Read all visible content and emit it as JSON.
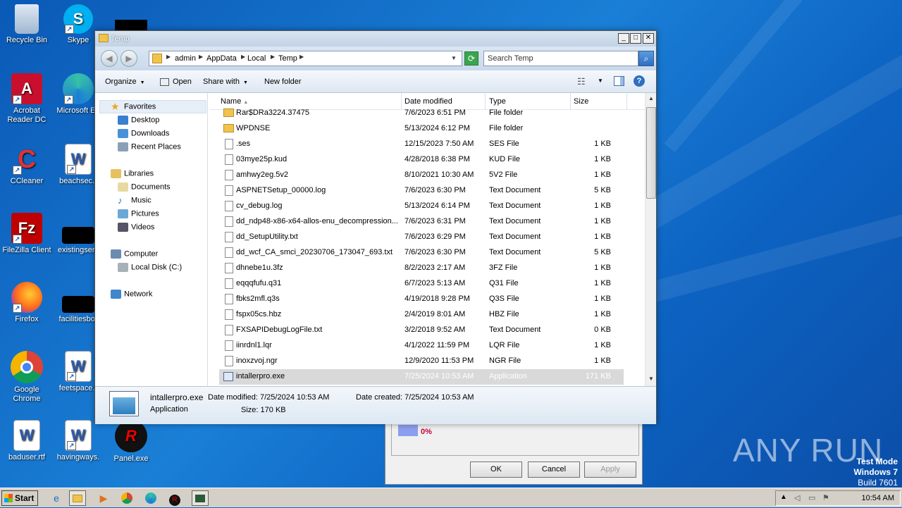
{
  "desktop": {
    "icons": [
      {
        "label": "Recycle Bin",
        "name": "recycle-bin-icon"
      },
      {
        "label": "Skype",
        "name": "skype-icon"
      },
      {
        "label": "Acrobat Reader DC",
        "name": "acrobat-icon"
      },
      {
        "label": "Microsoft Ed",
        "name": "edge-icon"
      },
      {
        "label": "CCleaner",
        "name": "ccleaner-icon"
      },
      {
        "label": "beachsec.r",
        "name": "word-doc-icon"
      },
      {
        "label": "FileZilla Client",
        "name": "filezilla-icon"
      },
      {
        "label": "existingserv",
        "name": "file-icon"
      },
      {
        "label": "Firefox",
        "name": "firefox-icon"
      },
      {
        "label": "facilitiesbor",
        "name": "file-icon"
      },
      {
        "label": "Google Chrome",
        "name": "chrome-icon"
      },
      {
        "label": "feetspace.r",
        "name": "word-doc-icon"
      },
      {
        "label": "baduser.rtf",
        "name": "word-doc-icon"
      },
      {
        "label": "havingways.",
        "name": "word-doc-icon"
      },
      {
        "label": "Panel.exe",
        "name": "redline-icon"
      }
    ],
    "watermark": "ANY RUN",
    "test_mode": {
      "line1": "Test Mode",
      "line2": "Windows 7",
      "line3": "Build 7601"
    }
  },
  "bg_dialog": {
    "progress_text": "0%",
    "progress_value": 0,
    "ok": "OK",
    "cancel": "Cancel",
    "apply": "Apply"
  },
  "window": {
    "title": "Temp",
    "breadcrumb": [
      "admin",
      "AppData",
      "Local",
      "Temp"
    ],
    "search_placeholder": "Search Temp",
    "toolbar": {
      "organize": "Organize",
      "open": "Open",
      "share_with": "Share with",
      "new_folder": "New folder"
    },
    "nav": {
      "favorites": "Favorites",
      "desktop": "Desktop",
      "downloads": "Downloads",
      "recent_places": "Recent Places",
      "libraries": "Libraries",
      "documents": "Documents",
      "music": "Music",
      "pictures": "Pictures",
      "videos": "Videos",
      "computer": "Computer",
      "local_disk": "Local Disk (C:)",
      "network": "Network"
    },
    "columns": {
      "name": "Name",
      "date": "Date modified",
      "type": "Type",
      "size": "Size"
    },
    "files": [
      {
        "name": "Rar$DRa3224.37475",
        "date": "7/6/2023 6:51 PM",
        "type": "File folder",
        "size": "",
        "kind": "folder"
      },
      {
        "name": "WPDNSE",
        "date": "5/13/2024 6:12 PM",
        "type": "File folder",
        "size": "",
        "kind": "folder"
      },
      {
        "name": ".ses",
        "date": "12/15/2023 7:50 AM",
        "type": "SES File",
        "size": "1 KB",
        "kind": "file"
      },
      {
        "name": "03mye25p.kud",
        "date": "4/28/2018 6:38 PM",
        "type": "KUD File",
        "size": "1 KB",
        "kind": "file"
      },
      {
        "name": "amhwy2eg.5v2",
        "date": "8/10/2021 10:30 AM",
        "type": "5V2 File",
        "size": "1 KB",
        "kind": "file"
      },
      {
        "name": "ASPNETSetup_00000.log",
        "date": "7/6/2023 6:30 PM",
        "type": "Text Document",
        "size": "5 KB",
        "kind": "file"
      },
      {
        "name": "cv_debug.log",
        "date": "5/13/2024 6:14 PM",
        "type": "Text Document",
        "size": "1 KB",
        "kind": "file"
      },
      {
        "name": "dd_ndp48-x86-x64-allos-enu_decompression...",
        "date": "7/6/2023 6:31 PM",
        "type": "Text Document",
        "size": "1 KB",
        "kind": "file"
      },
      {
        "name": "dd_SetupUtility.txt",
        "date": "7/6/2023 6:29 PM",
        "type": "Text Document",
        "size": "1 KB",
        "kind": "file"
      },
      {
        "name": "dd_wcf_CA_smci_20230706_173047_693.txt",
        "date": "7/6/2023 6:30 PM",
        "type": "Text Document",
        "size": "5 KB",
        "kind": "file"
      },
      {
        "name": "dhnebe1u.3fz",
        "date": "8/2/2023 2:17 AM",
        "type": "3FZ File",
        "size": "1 KB",
        "kind": "file"
      },
      {
        "name": "eqqqfufu.q31",
        "date": "6/7/2023 5:13 AM",
        "type": "Q31 File",
        "size": "1 KB",
        "kind": "file"
      },
      {
        "name": "fbks2mfl.q3s",
        "date": "4/19/2018 9:28 PM",
        "type": "Q3S File",
        "size": "1 KB",
        "kind": "file"
      },
      {
        "name": "fspx05cs.hbz",
        "date": "2/4/2019 8:01 AM",
        "type": "HBZ File",
        "size": "1 KB",
        "kind": "file"
      },
      {
        "name": "FXSAPIDebugLogFile.txt",
        "date": "3/2/2018 9:52 AM",
        "type": "Text Document",
        "size": "0 KB",
        "kind": "file"
      },
      {
        "name": "iinrdnl1.lqr",
        "date": "4/1/2022 11:59 PM",
        "type": "LQR File",
        "size": "1 KB",
        "kind": "file"
      },
      {
        "name": "inoxzvoj.ngr",
        "date": "12/9/2020 11:53 PM",
        "type": "NGR File",
        "size": "1 KB",
        "kind": "file"
      },
      {
        "name": "intallerpro.exe",
        "date": "7/25/2024 10:53 AM",
        "type": "Application",
        "size": "171 KB",
        "kind": "app",
        "selected": true
      }
    ],
    "details": {
      "name": "intallerpro.exe",
      "kind": "Application",
      "modified_label": "Date modified:",
      "modified": "7/25/2024 10:53 AM",
      "created_label": "Date created:",
      "created": "7/25/2024 10:53 AM",
      "size_label": "Size:",
      "size": "170 KB"
    }
  },
  "taskbar": {
    "start": "Start",
    "clock": "10:54 AM"
  }
}
